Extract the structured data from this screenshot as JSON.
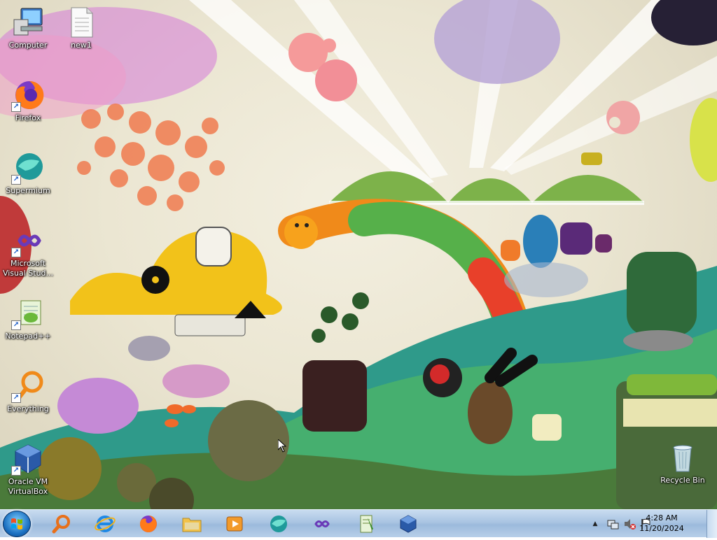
{
  "desktop_icons": [
    {
      "label": "Computer",
      "icon": "computer-icon",
      "shortcut": false
    },
    {
      "label": "new1",
      "icon": "text-file-icon",
      "shortcut": false
    },
    {
      "label": "Firefox",
      "icon": "firefox-icon",
      "shortcut": true
    },
    {
      "label": "Supermium",
      "icon": "supermium-icon",
      "shortcut": true
    },
    {
      "label": "Microsoft\nVisual Stud...",
      "icon": "visual-studio-icon",
      "shortcut": true
    },
    {
      "label": "Notepad++",
      "icon": "notepadpp-icon",
      "shortcut": true
    },
    {
      "label": "Everything",
      "icon": "everything-icon",
      "shortcut": true
    },
    {
      "label": "Oracle VM\nVirtualBox",
      "icon": "virtualbox-icon",
      "shortcut": true
    },
    {
      "label": "Recycle Bin",
      "icon": "recycle-bin-icon",
      "shortcut": false
    }
  ],
  "taskbar": {
    "start_label": "Start",
    "pinned": [
      "search-icon",
      "internet-explorer-icon",
      "firefox-icon",
      "file-explorer-icon",
      "media-player-icon",
      "supermium-icon",
      "visual-studio-icon",
      "notepadpp-icon",
      "virtualbox-icon"
    ]
  },
  "tray": {
    "icons": [
      "show-hidden-icons-icon",
      "network-icon",
      "volume-muted-icon",
      "action-center-flag-icon"
    ],
    "time": "4:28 AM",
    "date": "11/20/2024"
  },
  "colors": {
    "taskbar": "#a9c4e2",
    "wallpaper_base": "#ebe6d2",
    "accent": "#1a6fc0"
  }
}
